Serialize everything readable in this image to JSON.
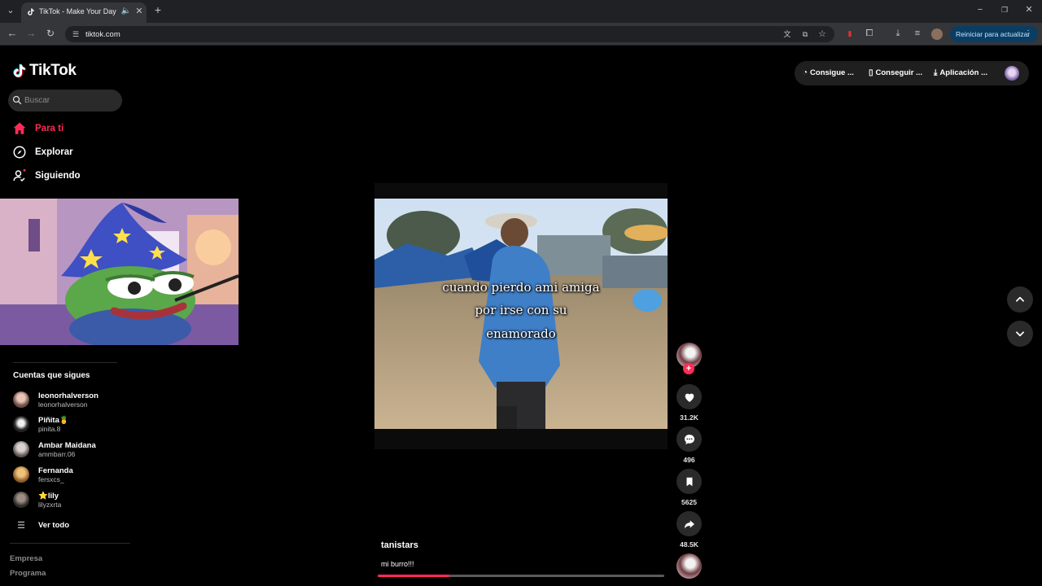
{
  "browser": {
    "tab_title": "TikTok - Make Your Day",
    "url": "tiktok.com",
    "update_button": "Reiniciar para actualizar"
  },
  "app": {
    "logo_text": "TikTok",
    "search_placeholder": "Buscar"
  },
  "nav": [
    {
      "label": "Para ti",
      "icon": "home-icon",
      "active": true
    },
    {
      "label": "Explorar",
      "icon": "compass-icon"
    },
    {
      "label": "Siguiendo",
      "icon": "following-icon"
    }
  ],
  "following_section": {
    "title": "Cuentas que sigues",
    "accounts": [
      {
        "name": "leonorhalverson",
        "handle": "leonorhalverson"
      },
      {
        "name": "Piñita🍍",
        "handle": "pinita.8"
      },
      {
        "name": "Ambar Maidana",
        "handle": "ammbarr.06"
      },
      {
        "name": "Fernanda",
        "handle": "fersxcs_"
      },
      {
        "name": "⭐lily",
        "handle": "lilyzxrta"
      }
    ],
    "see_all": "Ver todo"
  },
  "footer_links": [
    "Empresa",
    "Programa"
  ],
  "top_pills": [
    "Consigue ...",
    "Conseguir ...",
    "Aplicación ..."
  ],
  "video": {
    "caption_lines": [
      "cuando pierdo ami amiga",
      "por irse con su",
      "enamorado"
    ],
    "author": "tanistars",
    "description": "mi burro!!!",
    "progress": 0.25
  },
  "actions": {
    "likes": "31.2K",
    "comments": "496",
    "saves": "5625",
    "shares": "48.5K"
  },
  "colors": {
    "accent": "#fe2c55",
    "background": "#000000",
    "surface": "#2a2a2a"
  }
}
